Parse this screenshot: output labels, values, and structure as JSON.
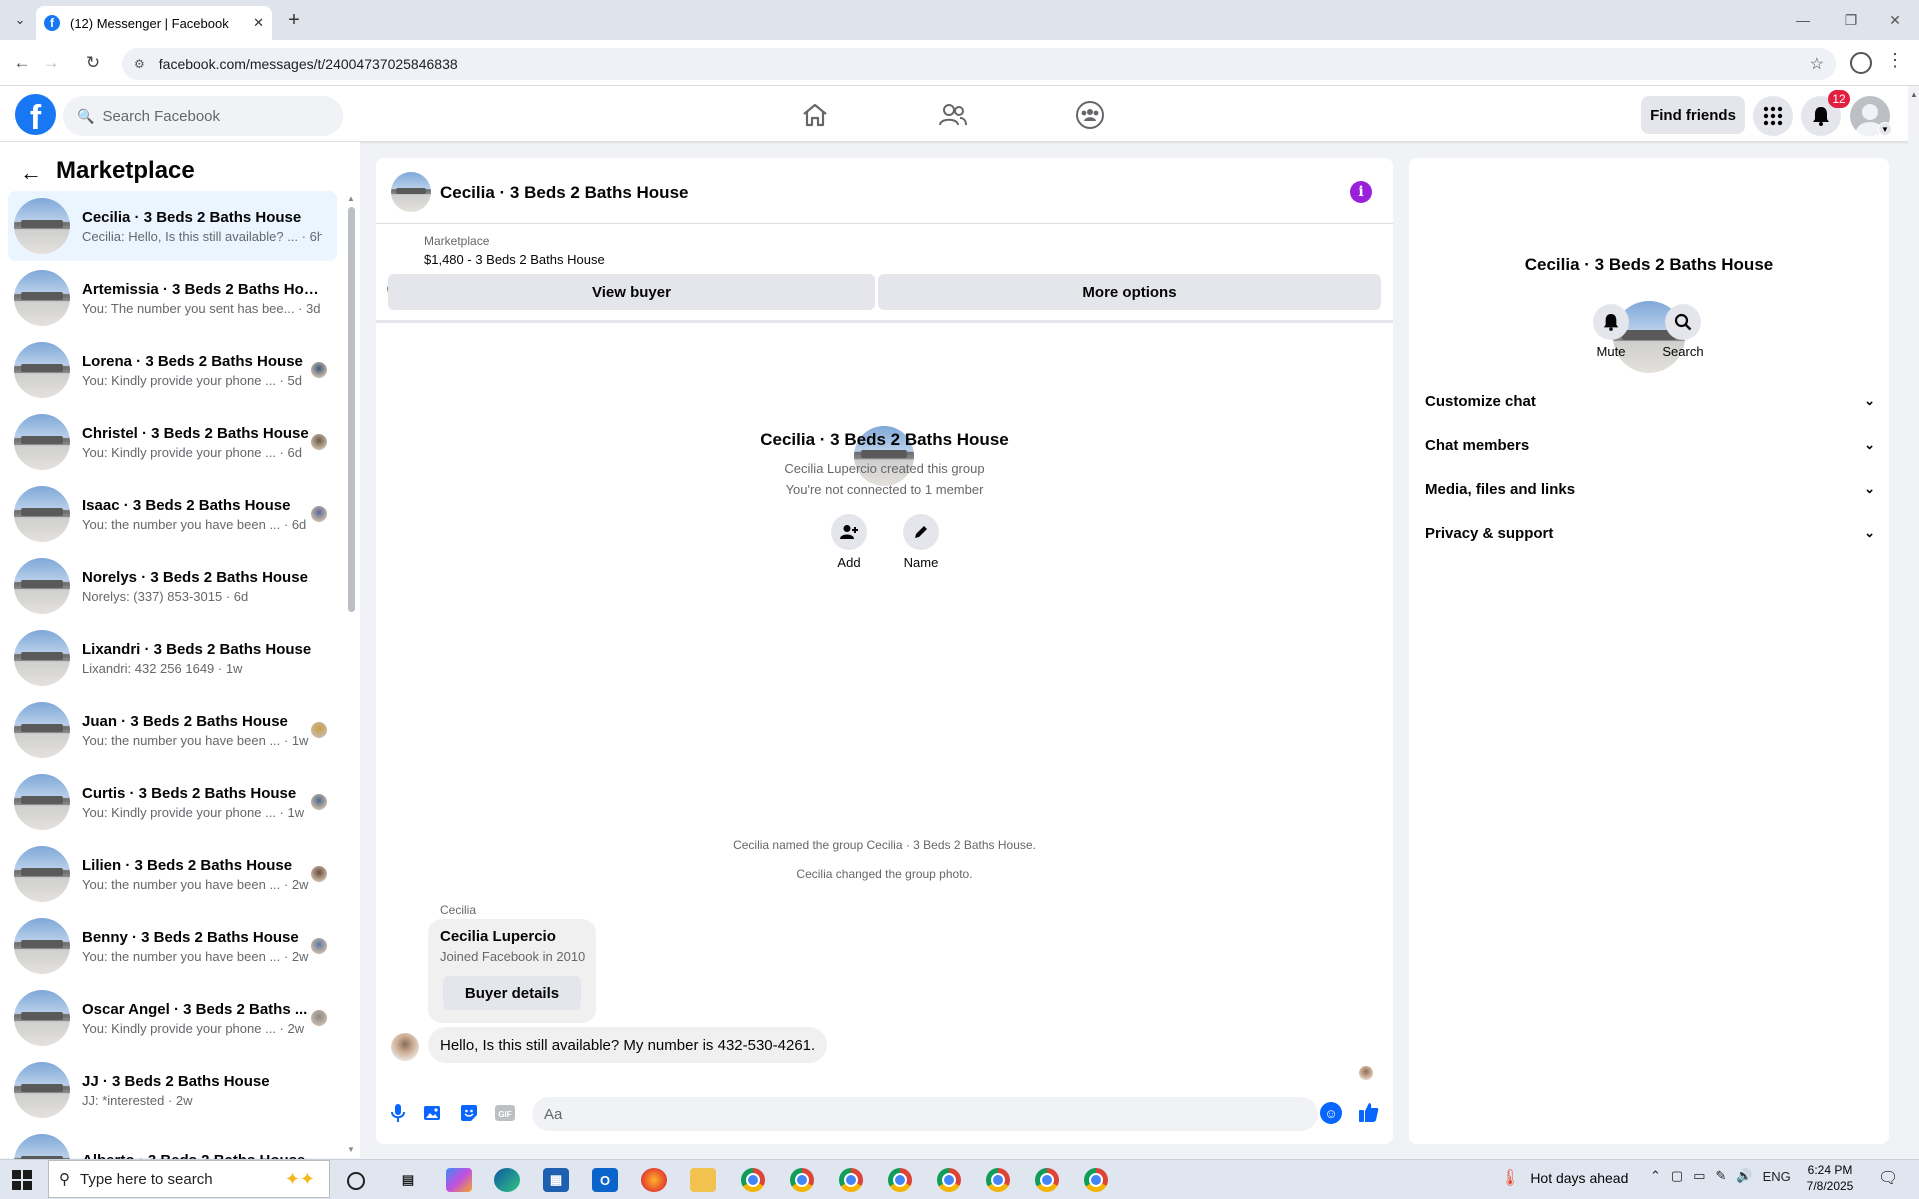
{
  "browser": {
    "tab_title": "(12) Messenger | Facebook",
    "url": "facebook.com/messages/t/24004737025846838"
  },
  "header": {
    "search_placeholder": "Search Facebook",
    "find_friends": "Find friends",
    "notification_count": "12",
    "brand_color": "#1877f2"
  },
  "sidebar": {
    "title": "Marketplace",
    "conversations": [
      {
        "name": "Cecilia · 3 Beds 2 Baths House",
        "preview": "Cecilia: Hello, Is this still available? ... · 6h",
        "active": true
      },
      {
        "name": "Artemissia · 3 Beds 2 Baths House",
        "preview": "You: The number you sent has bee... · 3d"
      },
      {
        "name": "Lorena · 3 Beds 2 Baths House",
        "preview": "You: Kindly provide your phone ... · 5d"
      },
      {
        "name": "Christel · 3 Beds 2 Baths House",
        "preview": "You: Kindly provide your phone ... · 6d"
      },
      {
        "name": "Isaac · 3 Beds 2 Baths House",
        "preview": "You: the number you have been ... · 6d"
      },
      {
        "name": "Norelys · 3 Beds 2 Baths House",
        "preview": "Norelys: (337) 853-3015 · 6d"
      },
      {
        "name": "Lixandri · 3 Beds 2 Baths House",
        "preview": "Lixandri: 432 256 1649 · 1w"
      },
      {
        "name": "Juan · 3 Beds 2 Baths House",
        "preview": "You: the number you have been ... · 1w"
      },
      {
        "name": "Curtis · 3 Beds 2 Baths House",
        "preview": "You: Kindly provide your phone ... · 1w"
      },
      {
        "name": "Lilien · 3 Beds 2 Baths House",
        "preview": "You: the number you have been ... · 2w"
      },
      {
        "name": "Benny · 3 Beds 2 Baths House",
        "preview": "You: the number you have been ... · 2w"
      },
      {
        "name": "Oscar Angel · 3 Beds 2 Baths ...",
        "preview": "You: Kindly provide your phone ... · 2w"
      },
      {
        "name": "JJ · 3 Beds 2 Baths House",
        "preview": "JJ: *interested · 2w"
      },
      {
        "name": "Alberto · 3 Beds 2 Baths House",
        "preview": ""
      }
    ]
  },
  "chat": {
    "title": "Cecilia · 3 Beds 2 Baths House",
    "marketplace_label": "Marketplace",
    "listing": "$1,480 - 3 Beds 2 Baths House",
    "view_buyer": "View buyer",
    "more_options": "More options",
    "intro_title": "Cecilia · 3 Beds 2 Baths House",
    "intro_created": "Cecilia Lupercio created this group",
    "intro_not_connected": "You're not connected to 1 member",
    "add_label": "Add",
    "name_label": "Name",
    "system_messages": [
      "Cecilia named the group Cecilia · 3 Beds 2 Baths House.",
      "Cecilia changed the group photo."
    ],
    "sender_name": "Cecilia",
    "card_name": "Cecilia Lupercio",
    "card_joined": "Joined Facebook in 2010",
    "buyer_details": "Buyer details",
    "message": "Hello, Is this still available? My number is 432-530-4261.",
    "input_placeholder": "Aa"
  },
  "details": {
    "title": "Cecilia · 3 Beds 2 Baths House",
    "mute": "Mute",
    "search": "Search",
    "sections": [
      "Customize chat",
      "Chat members",
      "Media, files and links",
      "Privacy & support"
    ]
  },
  "taskbar": {
    "search_placeholder": "Type here to search",
    "weather": "Hot days ahead",
    "lang": "ENG",
    "time": "6:24 PM",
    "date": "7/8/2025"
  }
}
